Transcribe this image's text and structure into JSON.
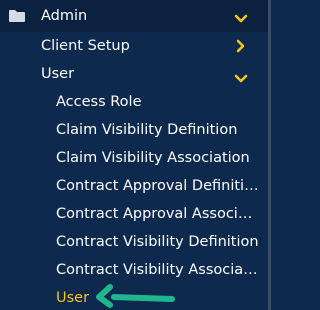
{
  "colors": {
    "background": "#0d2a4e",
    "header_background": "#0a2240",
    "text": "#ffffff",
    "accent_active": "#f5c518",
    "chevron": "#f5c518",
    "pointer_arrow": "#1fb58f"
  },
  "admin": {
    "label": "Admin",
    "icon": "folder-icon",
    "expanded": true
  },
  "client_setup": {
    "label": "Client Setup",
    "expanded": false
  },
  "user_group": {
    "label": "User",
    "expanded": true,
    "items": [
      {
        "label": "Access Role"
      },
      {
        "label": "Claim Visibility Definition"
      },
      {
        "label": "Claim Visibility Association"
      },
      {
        "label": "Contract Approval Definition"
      },
      {
        "label": "Contract Approval Associati..."
      },
      {
        "label": "Contract Visibility Definition"
      },
      {
        "label": "Contract Visibility Associati..."
      },
      {
        "label": "User",
        "active": true
      }
    ]
  }
}
